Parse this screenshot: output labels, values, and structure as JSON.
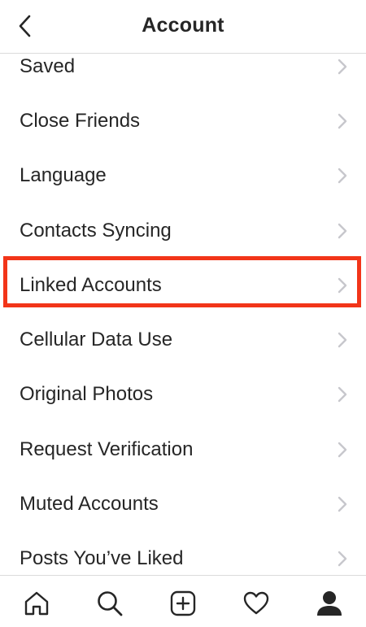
{
  "header": {
    "title": "Account",
    "back_icon": "chevron-left-icon"
  },
  "menu": {
    "items": [
      {
        "label": "Saved"
      },
      {
        "label": "Close Friends"
      },
      {
        "label": "Language"
      },
      {
        "label": "Contacts Syncing"
      },
      {
        "label": "Linked Accounts",
        "highlighted": true
      },
      {
        "label": "Cellular Data Use"
      },
      {
        "label": "Original Photos"
      },
      {
        "label": "Request Verification"
      },
      {
        "label": "Muted Accounts"
      },
      {
        "label": "Posts You’ve Liked"
      }
    ]
  },
  "colors": {
    "highlight": "#f23519",
    "text": "#262626",
    "chevron": "#c7c7cc",
    "divider": "#dbdbdb"
  },
  "tabbar": {
    "tabs": [
      "home-icon",
      "search-icon",
      "add-post-icon",
      "activity-heart-icon",
      "profile-icon"
    ],
    "active": "profile-icon"
  }
}
